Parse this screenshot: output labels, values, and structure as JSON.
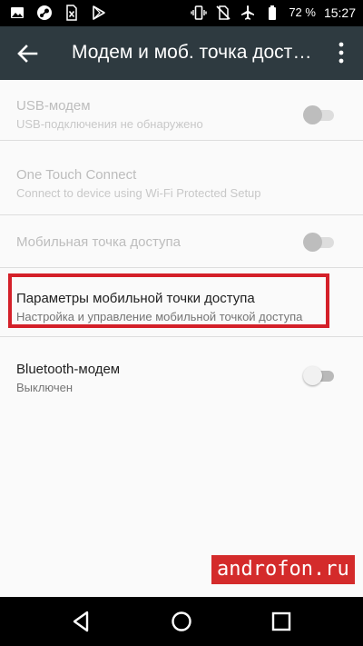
{
  "status_bar": {
    "battery_percent": "72 %",
    "time": "15:27",
    "left_icons": [
      "gallery-icon",
      "steam-icon",
      "file-x-icon",
      "play-store-icon"
    ],
    "right_icons": [
      "vibrate-icon",
      "no-sim-icon",
      "airplane-icon",
      "battery-icon"
    ]
  },
  "toolbar": {
    "title": "Модем и моб. точка доступа",
    "background": "#2e3a40"
  },
  "settings": {
    "usb": {
      "title": "USB-модем",
      "subtitle": "USB-подключения не обнаружено",
      "enabled": false,
      "checked": false
    },
    "one_touch": {
      "title": "One Touch Connect",
      "subtitle": "Connect to device using Wi-Fi Protected Setup",
      "enabled": false
    },
    "hotspot": {
      "title": "Мобильная точка доступа",
      "enabled": false,
      "checked": false
    },
    "hotspot_params": {
      "title": "Параметры мобильной точки доступа",
      "subtitle": "Настройка и управление мобильной точкой доступа",
      "highlighted": true,
      "highlight_color": "#d42029"
    },
    "bluetooth": {
      "title": "Bluetooth-модем",
      "subtitle": "Выключен",
      "enabled": true,
      "checked": false
    }
  },
  "watermark": {
    "text": "androfon.ru",
    "color": "#d42b2b"
  },
  "nav_bar": {
    "buttons": [
      "back-triangle-icon",
      "home-circle-icon",
      "recents-square-icon"
    ]
  }
}
